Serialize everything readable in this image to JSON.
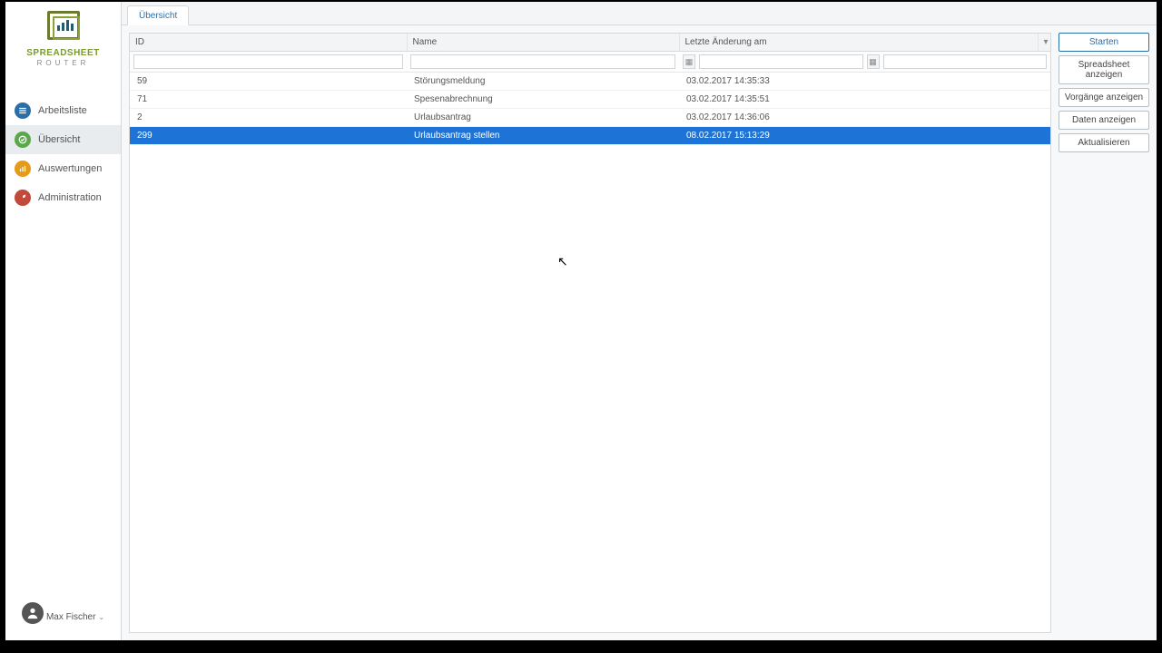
{
  "brand": {
    "title": "SPREADSHEET",
    "subtitle": "ROUTER"
  },
  "nav": {
    "items": [
      {
        "label": "Arbeitsliste",
        "iconClass": "ic-blue"
      },
      {
        "label": "Übersicht",
        "iconClass": "ic-green"
      },
      {
        "label": "Auswertungen",
        "iconClass": "ic-orange"
      },
      {
        "label": "Administration",
        "iconClass": "ic-red"
      }
    ],
    "activeIndex": 1
  },
  "user": {
    "name": "Max Fischer"
  },
  "tabs": {
    "active": "Übersicht"
  },
  "grid": {
    "columns": {
      "id": "ID",
      "name": "Name",
      "date": "Letzte Änderung am"
    },
    "rows": [
      {
        "id": "59",
        "name": "Störungsmeldung",
        "date": "03.02.2017 14:35:33",
        "selected": false
      },
      {
        "id": "71",
        "name": "Spesenabrechnung",
        "date": "03.02.2017 14:35:51",
        "selected": false
      },
      {
        "id": "2",
        "name": "Urlaubsantrag",
        "date": "03.02.2017 14:36:06",
        "selected": false
      },
      {
        "id": "299",
        "name": "Urlaubsantrag stellen",
        "date": "08.02.2017 15:13:29",
        "selected": true
      }
    ]
  },
  "actions": {
    "start": "Starten",
    "showSpreadsheet": "Spreadsheet anzeigen",
    "showProcesses": "Vorgänge anzeigen",
    "showData": "Daten anzeigen",
    "refresh": "Aktualisieren"
  }
}
